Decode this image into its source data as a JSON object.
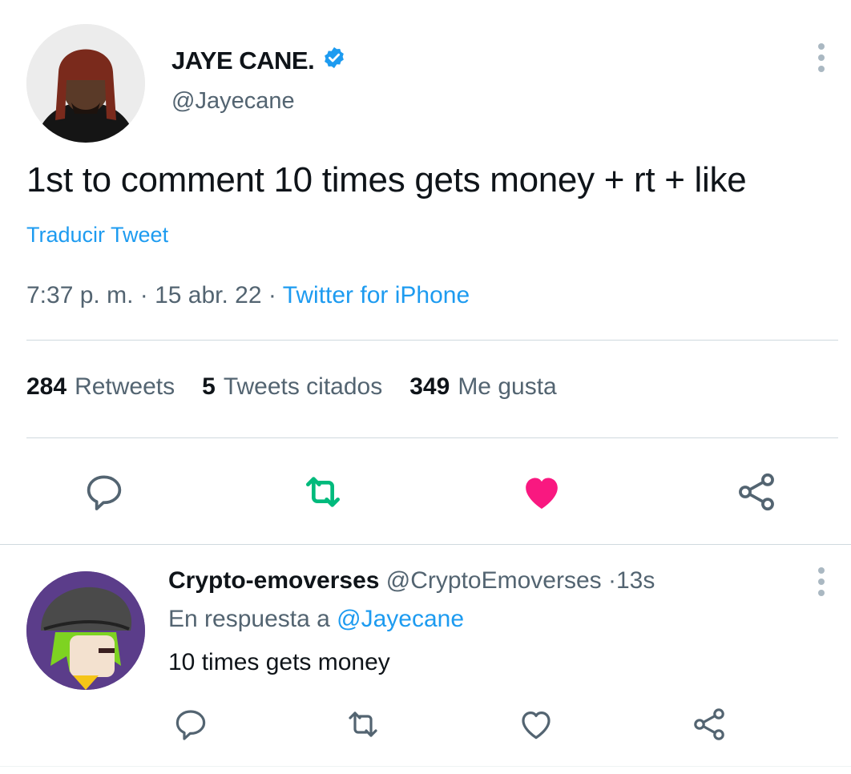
{
  "tweet": {
    "author_name": "JAYE CANE.",
    "author_handle": "@Jayecane",
    "verified_icon": "verified-badge-icon",
    "text": "1st to comment 10 times gets money + rt + like",
    "translate_label": "Traducir Tweet",
    "time": "7:37 p. m.",
    "separator": "·",
    "date": "15 abr. 22",
    "source": "Twitter for iPhone",
    "stats": {
      "retweets_count": "284",
      "retweets_label": "Retweets",
      "quotes_count": "5",
      "quotes_label": "Tweets citados",
      "likes_count": "349",
      "likes_label": "Me gusta"
    },
    "colors": {
      "retweet_active": "#00ba7c",
      "like_active": "#f91880",
      "link": "#1d9bf0",
      "muted": "#536471"
    }
  },
  "reply": {
    "author_name": "Crypto-emoverses",
    "author_handle": "@CryptoEmoverses",
    "separator": "·",
    "time_ago": "13s",
    "in_reply_prefix": "En respuesta a",
    "in_reply_handle": "@Jayecane",
    "text": "10 times gets money"
  }
}
